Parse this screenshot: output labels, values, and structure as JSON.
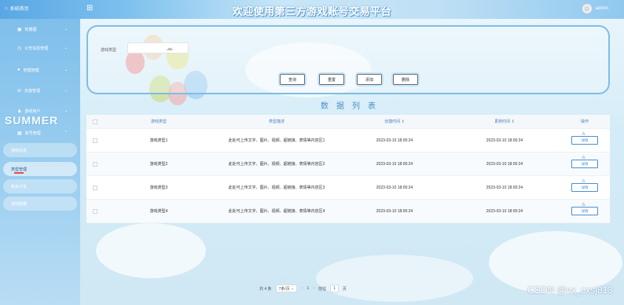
{
  "header": {
    "home_label": "系统首页",
    "title": "欢迎使用第三方游戏账号交易平台",
    "user_name": "admin"
  },
  "sidebar": {
    "items": [
      {
        "label": "轮播图"
      },
      {
        "label": "公告信息管理"
      },
      {
        "label": "管理管理"
      },
      {
        "label": "充值管理"
      },
      {
        "label": "游戏用户"
      },
      {
        "label": "账号管理"
      }
    ],
    "decor_text": "SUMMER",
    "sub_items": [
      {
        "label": "游戏信息"
      },
      {
        "label": "类型管理"
      },
      {
        "label": "购买订单"
      },
      {
        "label": "游戏数据"
      }
    ]
  },
  "search": {
    "label": "游戏类型",
    "placeholder": ""
  },
  "buttons": {
    "query": "查询",
    "reset": "重置",
    "add": "添加",
    "delete": "删除"
  },
  "list_title": "数据列表",
  "table": {
    "columns": [
      "游戏类型",
      "类型描述",
      "创建时间 ⇕",
      "更新时间 ⇕",
      "操作"
    ],
    "rows": [
      {
        "type": "游戏类型1",
        "desc": "此处可上传文字、图片、视频、超链接、表情等内容区1",
        "created": "2023-03-10 18:00:24",
        "updated": "2023-03-10 18:00:24",
        "action": "详情"
      },
      {
        "type": "游戏类型2",
        "desc": "此处可上传文字、图片、视频、超链接、表情等内容区2",
        "created": "2023-03-10 18:00:24",
        "updated": "2023-03-10 18:00:24",
        "action": "详情"
      },
      {
        "type": "游戏类型3",
        "desc": "此处可上传文字、图片、视频、超链接、表情等内容区3",
        "created": "2023-03-10 18:00:24",
        "updated": "2023-03-10 18:00:24",
        "action": "详情"
      },
      {
        "type": "游戏类型4",
        "desc": "此处可上传文字、图片、视频、超链接、表情等内容区4",
        "created": "2023-03-10 18:00:24",
        "updated": "2023-03-10 18:00:24",
        "action": "详情"
      }
    ]
  },
  "pagination": {
    "total": "共 4 条",
    "page_size": "7条/页",
    "current": "1",
    "goto_label": "前往",
    "goto_value": "1",
    "page_suffix": "页"
  },
  "watermark": "CSDN @vx_cxsj813"
}
